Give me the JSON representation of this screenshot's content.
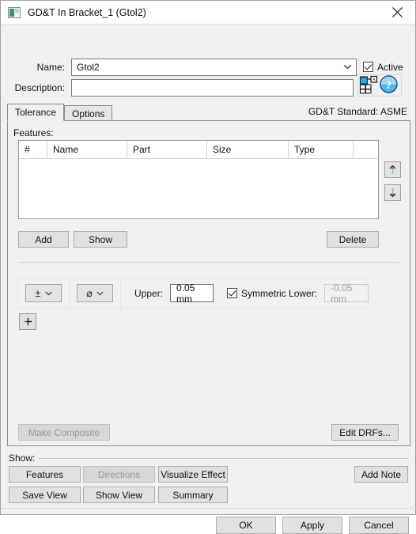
{
  "window": {
    "title": "GD&T In Bracket_1 (Gtol2)",
    "icon": "gdt-window-icon",
    "close_label": "close-icon"
  },
  "form": {
    "name_label": "Name:",
    "name_value": "Gtol2",
    "description_label": "Description:",
    "description_value": "",
    "active_label": "Active",
    "active_checked": true,
    "symbol_button_icon": "insert-symbol-icon",
    "help_button_icon": "help-icon"
  },
  "tabs": [
    {
      "label": "Tolerance",
      "active": true
    },
    {
      "label": "Options",
      "active": false
    }
  ],
  "standard": {
    "text": "GD&T Standard: ASME"
  },
  "features": {
    "label": "Features:",
    "columns": [
      "#",
      "Name",
      "Part",
      "Size",
      "Type",
      ""
    ],
    "rows": [],
    "move_up_icon": "arrow-up-icon",
    "move_down_icon": "arrow-down-icon",
    "add_label": "Add",
    "show_label": "Show",
    "delete_label": "Delete"
  },
  "tolerance": {
    "symbol_primary": "±",
    "symbol_modifier": "⌀",
    "upper_label": "Upper:",
    "upper_value": "0.05 mm",
    "symmetric_label": "Symmetric Lower:",
    "symmetric_checked": true,
    "lower_value": "-0.05 mm",
    "lower_disabled": true,
    "add_row_label": "+"
  },
  "composite": {
    "make_composite_label": "Make Composite",
    "make_composite_disabled": true,
    "edit_drfs_label": "Edit DRFs..."
  },
  "show_group": {
    "label": "Show:",
    "buttons": [
      {
        "label": "Features",
        "disabled": false
      },
      {
        "label": "Directions",
        "disabled": true
      },
      {
        "label": "Visualize Effect",
        "disabled": false
      },
      {
        "label": "Save View",
        "disabled": false
      },
      {
        "label": "Show View",
        "disabled": false
      },
      {
        "label": "Summary",
        "disabled": false
      }
    ],
    "add_note_label": "Add Note"
  },
  "footer": {
    "ok_label": "OK",
    "apply_label": "Apply",
    "cancel_label": "Cancel"
  },
  "colors": {
    "dialog_bg": "#f0f0f0",
    "field_bg": "#ffffff",
    "button_bg": "#e1e1e1",
    "border": "#a0a0a0",
    "disabled_text": "#9a9a9a",
    "icon_accent": "#2b8fd0"
  }
}
